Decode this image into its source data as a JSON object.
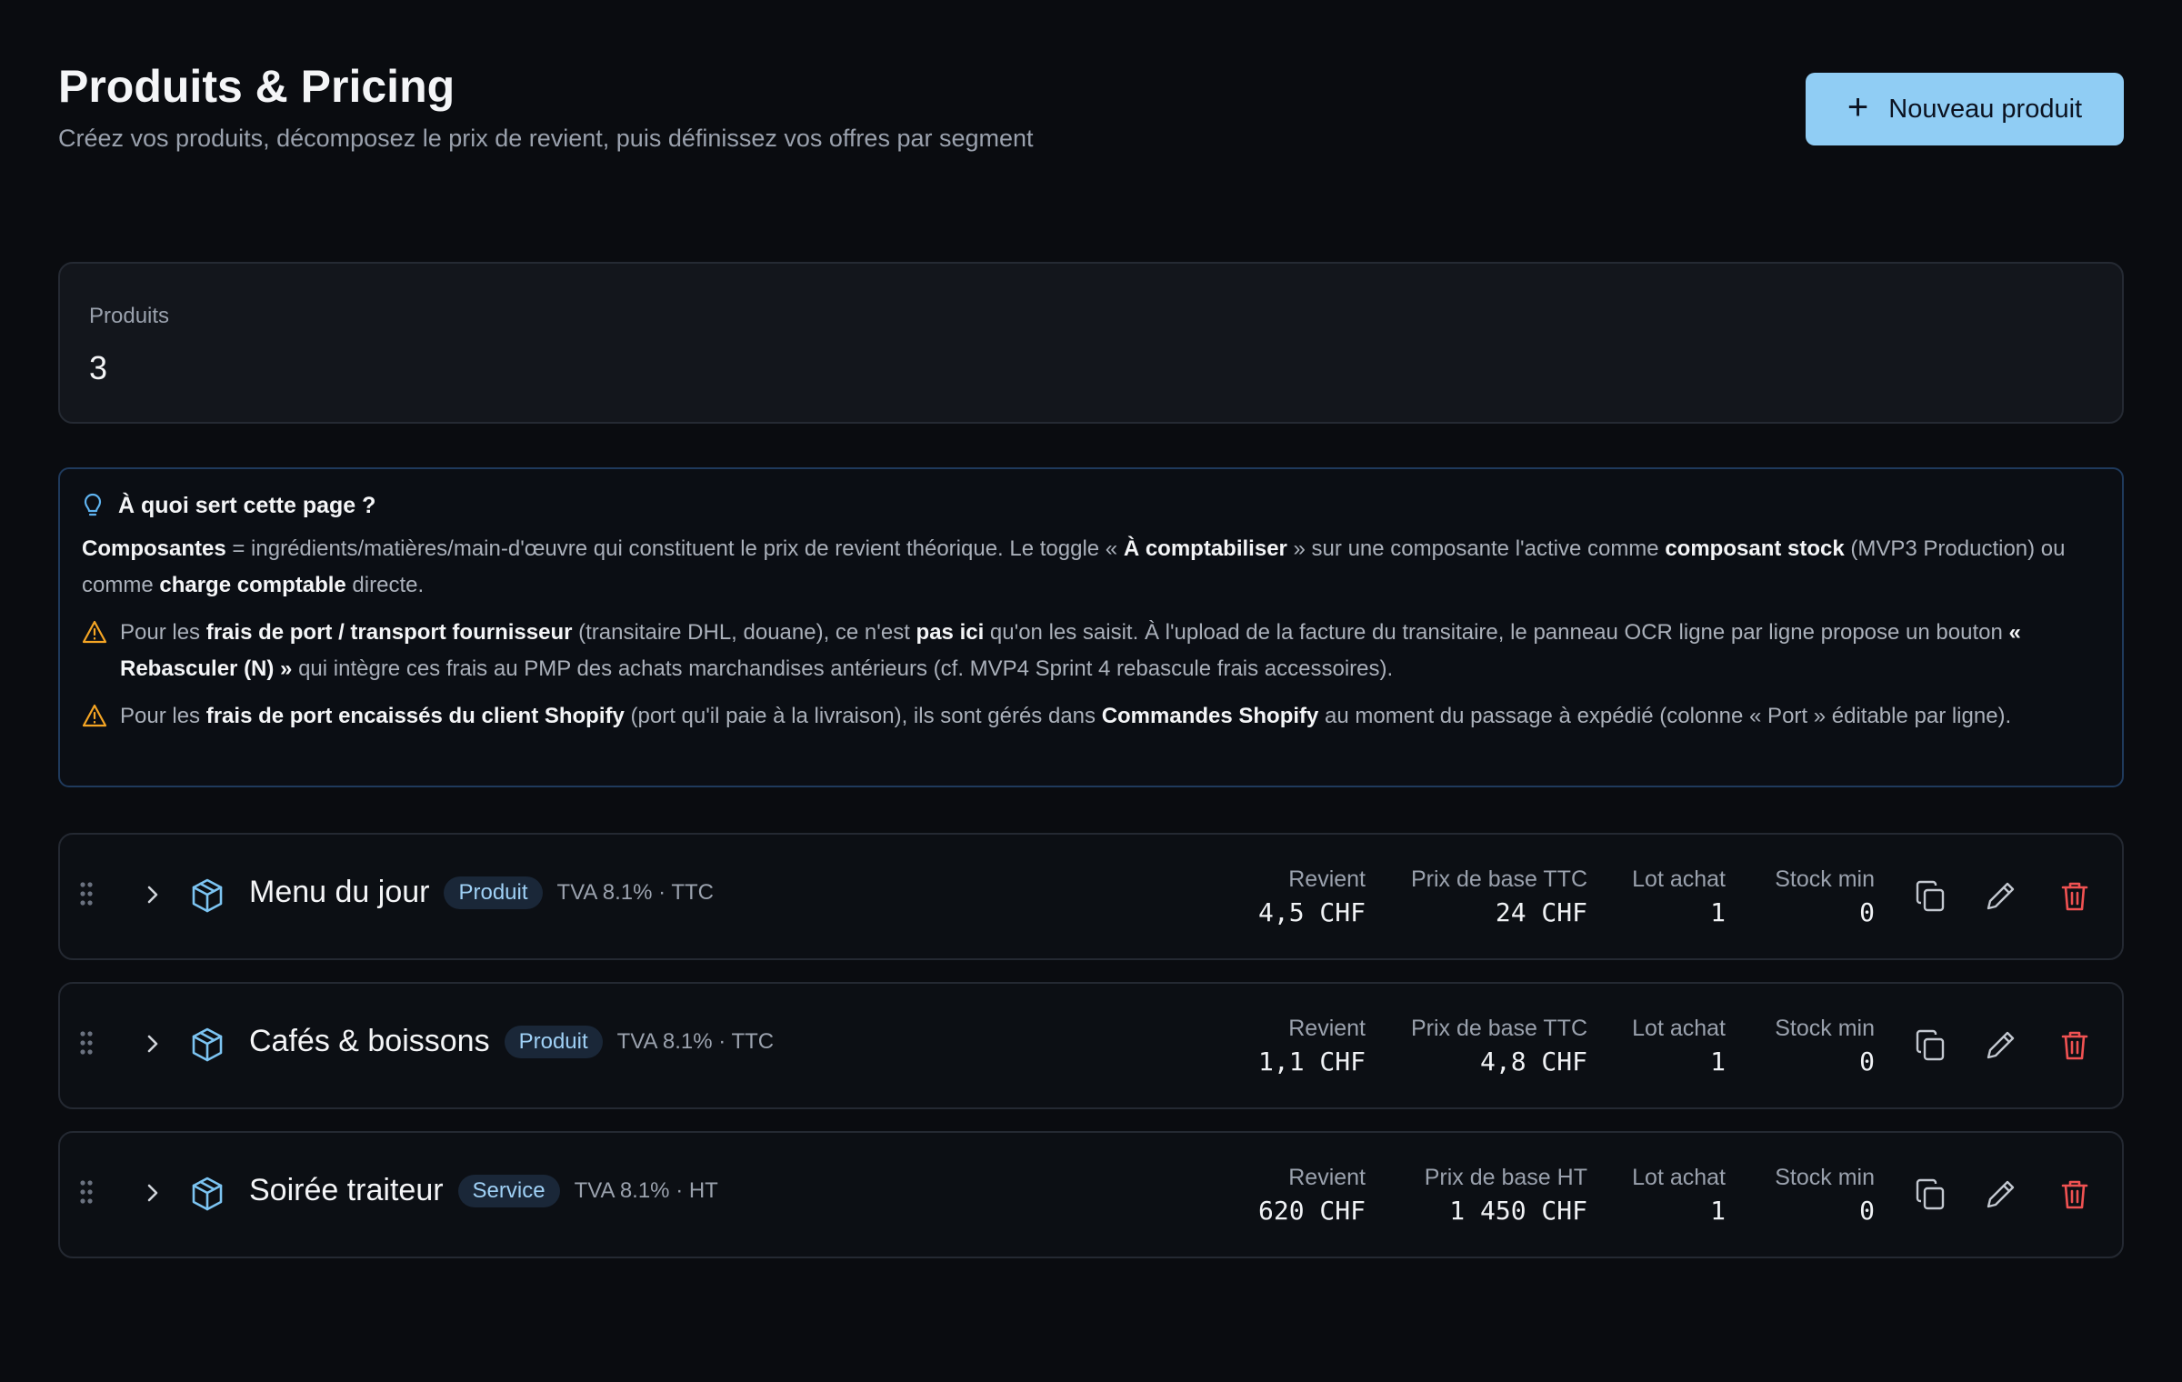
{
  "header": {
    "title": "Produits & Pricing",
    "subtitle": "Créez vos produits, décomposez le prix de revient, puis définissez vos offres par segment",
    "new_button_label": "Nouveau produit"
  },
  "stats": {
    "label": "Produits",
    "value": "3"
  },
  "info": {
    "title": "À quoi sert cette page ?",
    "p1": {
      "b1": "Composantes",
      "t1": " = ingrédients/matières/main-d'œuvre qui constituent le prix de revient théorique. Le toggle « ",
      "b2": "À comptabiliser",
      "t2": " » sur une composante l'active comme ",
      "b3": "composant stock",
      "t3": " (MVP3 Production) ou comme ",
      "b4": "charge comptable",
      "t4": " directe."
    },
    "w1": {
      "t1": "Pour les ",
      "b1": "frais de port / transport fournisseur",
      "t2": " (transitaire DHL, douane), ce n'est ",
      "b2": "pas ici",
      "t3": " qu'on les saisit. À l'upload de la facture du transitaire, le panneau OCR ligne par ligne propose un bouton ",
      "b3": "« Rebasculer (N) »",
      "t4": " qui intègre ces frais au PMP des achats marchandises antérieurs (cf. MVP4 Sprint 4 rebascule frais accessoires)."
    },
    "w2": {
      "t1": "Pour les ",
      "b1": "frais de port encaissés du client Shopify",
      "t2": " (port qu'il paie à la livraison), ils sont gérés dans ",
      "b2": "Commandes Shopify",
      "t3": " au moment du passage à expédié (colonne « Port » éditable par ligne)."
    }
  },
  "columns": {
    "revient": "Revient",
    "lot": "Lot achat",
    "stock": "Stock min"
  },
  "products": [
    {
      "name": "Menu du jour",
      "type": "Produit",
      "tva": "TVA 8.1% · TTC",
      "revient": "4,5 CHF",
      "prix_label": "Prix de base TTC",
      "prix": "24 CHF",
      "lot": "1",
      "stock": "0"
    },
    {
      "name": "Cafés & boissons",
      "type": "Produit",
      "tva": "TVA 8.1% · TTC",
      "revient": "1,1 CHF",
      "prix_label": "Prix de base TTC",
      "prix": "4,8 CHF",
      "lot": "1",
      "stock": "0"
    },
    {
      "name": "Soirée traiteur",
      "type": "Service",
      "tva": "TVA 8.1% · HT",
      "revient": "620 CHF",
      "prix_label": "Prix de base HT",
      "prix": "1 450 CHF",
      "lot": "1",
      "stock": "0"
    }
  ],
  "colors": {
    "accent": "#90cdf4",
    "danger": "#f05252",
    "warning": "#f5a524",
    "info": "#5fb3f0"
  }
}
